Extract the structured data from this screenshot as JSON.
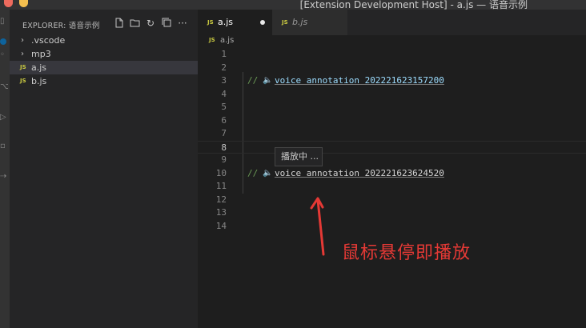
{
  "window": {
    "title": "[Extension Development Host] - a.js — 语音示例"
  },
  "activity_bar": {
    "badge": "1"
  },
  "sidebar": {
    "title": "EXPLORER: 语音示例",
    "actions": [
      {
        "name": "new-file-icon",
        "glyph": "+"
      },
      {
        "name": "new-folder-icon",
        "glyph": "⊞"
      },
      {
        "name": "refresh-icon",
        "glyph": "↻"
      },
      {
        "name": "collapse-all-icon",
        "glyph": "⧉"
      },
      {
        "name": "more-icon",
        "glyph": "···"
      }
    ],
    "items": [
      {
        "label": ".vscode",
        "kind": "folder"
      },
      {
        "label": "mp3",
        "kind": "folder"
      },
      {
        "label": "a.js",
        "kind": "file",
        "icon_text": "JS",
        "selected": true
      },
      {
        "label": "b.js",
        "kind": "file",
        "icon_text": "JS"
      }
    ]
  },
  "tabs": [
    {
      "label": "a.js",
      "icon_text": "JS",
      "active": true,
      "dirty": true
    },
    {
      "label": "b.js",
      "icon_text": "JS",
      "active": false
    }
  ],
  "breadcrumb": {
    "icon_text": "JS",
    "label": "a.js"
  },
  "code": {
    "lines": [
      "1",
      "2",
      "3",
      "4",
      "5",
      "6",
      "7",
      "8",
      "9",
      "10",
      "11",
      "12",
      "13",
      "14"
    ],
    "current_line": "8",
    "comment_prefix": "//",
    "speaker_glyph": "🔈",
    "annotation_line3": "voice annotation 202221623157200",
    "annotation_line10": "voice annotation 202221623624520"
  },
  "hover": {
    "text": "播放中 ..."
  },
  "overlay": {
    "label": "鼠标悬停即播放",
    "color": "#e53935"
  },
  "colors": {
    "comment": "#6a9955",
    "link": "#9cdcfe",
    "js_icon": "#cbcb41"
  }
}
